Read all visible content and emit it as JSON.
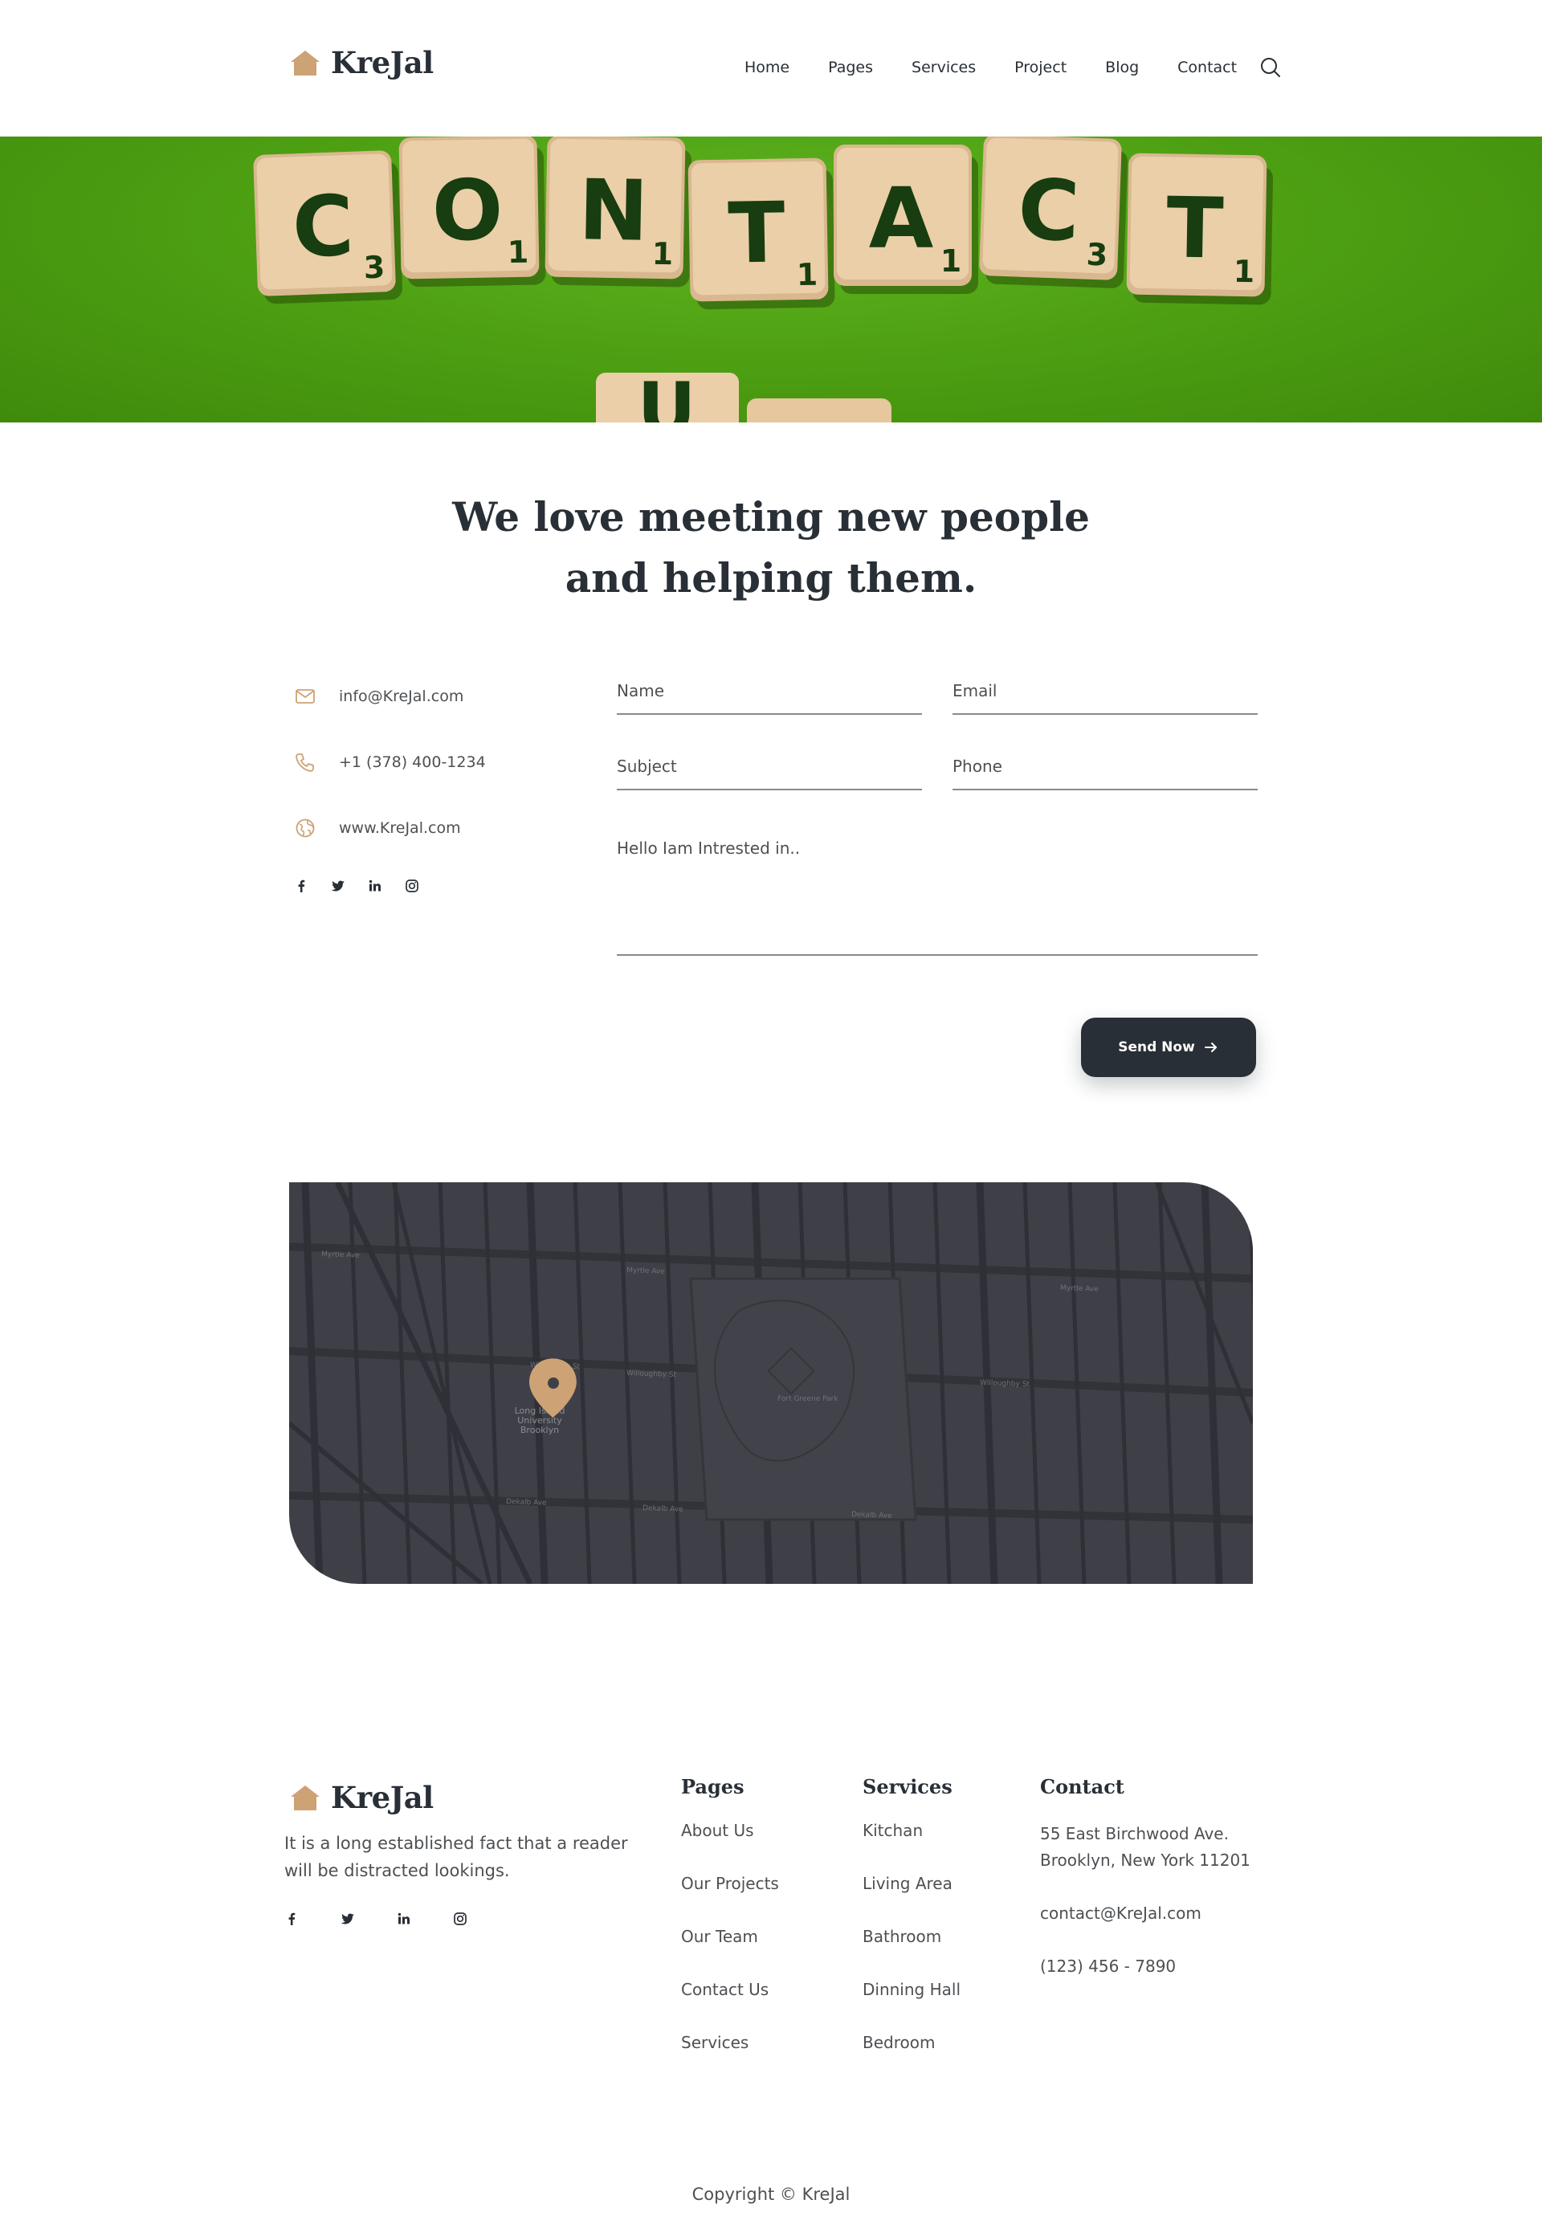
{
  "brand": {
    "name": "KreJal",
    "accent": "#cda274",
    "dark": "#292f36"
  },
  "nav": {
    "items": [
      "Home",
      "Pages",
      "Services",
      "Project",
      "Blog",
      "Contact"
    ],
    "search_icon": "search-icon"
  },
  "banner": {
    "image": "scrabble tiles spelling contact on green background",
    "tiles": [
      "C",
      "O",
      "N",
      "T",
      "A",
      "C",
      "T"
    ],
    "scores": [
      "3",
      "1",
      "1",
      "1",
      "1",
      "3",
      "1"
    ]
  },
  "headline": {
    "line1": "We love meeting new people",
    "line2": "and helping them."
  },
  "contact_info": {
    "email": "info@KreJal.com",
    "phone": "+1 (378) 400-1234",
    "website": "www.KreJal.com",
    "icons": [
      "mail-icon",
      "phone-icon",
      "globe-icon"
    ],
    "social": [
      "facebook-icon",
      "twitter-icon",
      "linkedin-icon",
      "instagram-icon"
    ]
  },
  "form": {
    "name_placeholder": "Name",
    "email_placeholder": "Email",
    "subject_placeholder": "Subject",
    "phone_placeholder": "Phone",
    "message_placeholder": "Hello Iam Intrested in..",
    "send_label": "Send Now"
  },
  "map": {
    "labels": [
      "Long Island University Brooklyn",
      "Myrtle Ave",
      "Willoughby St",
      "Dekalb Ave",
      "Fort Greene Park"
    ],
    "marker_color": "#cda274"
  },
  "footer": {
    "description": "It is a long established fact that a reader will be distracted lookings.",
    "pages_title": "Pages",
    "pages": [
      "About Us",
      "Our Projects",
      "Our Team",
      "Contact Us",
      "Services"
    ],
    "services_title": "Services",
    "services": [
      "Kitchan",
      "Living Area",
      "Bathroom",
      "Dinning Hall",
      "Bedroom"
    ],
    "contact_title": "Contact",
    "address_line1": "55 East Birchwood Ave.",
    "address_line2": "Brooklyn, New York 11201",
    "email": "contact@KreJal.com",
    "phone": "(123) 456 - 7890",
    "copyright": "Copyright © KreJal"
  }
}
